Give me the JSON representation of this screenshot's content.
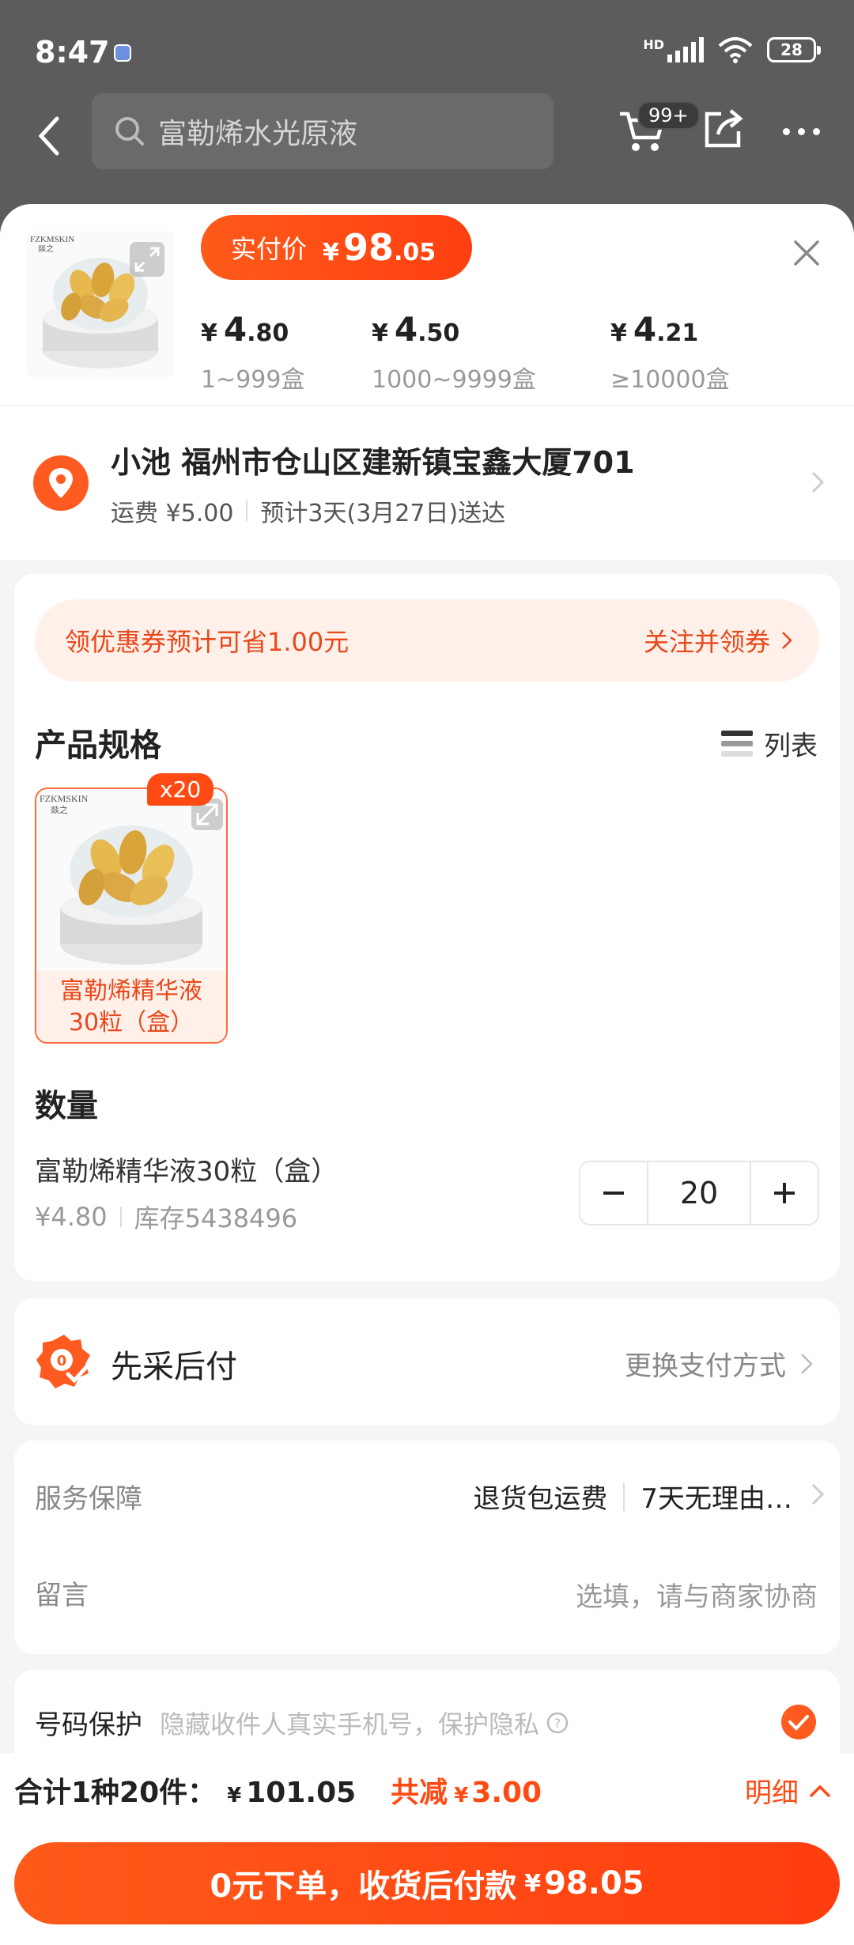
{
  "status_bar": {
    "time": "8:47",
    "network": "HD",
    "battery": "28"
  },
  "nav": {
    "search_text": "富勒烯水光原液",
    "cart_count": "99+"
  },
  "product": {
    "brand_mark": "FZKMSKIN",
    "brand_sub": "燚之",
    "price_label": "实付价",
    "currency": "¥",
    "price_int": "98",
    "price_dec": ".05",
    "tiers": [
      {
        "int": "4",
        "dec": ".80",
        "range": "1~999盒"
      },
      {
        "int": "4",
        "dec": ".50",
        "range": "1000~9999盒"
      },
      {
        "int": "4",
        "dec": ".21",
        "range": "≥10000盒"
      }
    ]
  },
  "address": {
    "line": "小池 福州市仓山区建新镇宝鑫大厦701",
    "shipping": "运费 ¥5.00",
    "eta": "预计3天(3月27日)送达"
  },
  "coupon": {
    "text": "领优惠券预计可省1.00元",
    "action": "关注并领券"
  },
  "spec": {
    "title": "产品规格",
    "view_label": "列表",
    "sku": {
      "line1": "富勒烯精华液",
      "line2": "30粒（盒）",
      "count": "x20"
    }
  },
  "quantity": {
    "title": "数量",
    "item_name": "富勒烯精华液30粒（盒）",
    "unit_price": "¥4.80",
    "stock": "库存5438496",
    "value": "20"
  },
  "payment": {
    "title": "先采后付",
    "action": "更换支付方式"
  },
  "service": {
    "label": "服务保障",
    "tag1": "退货包运费",
    "tag2": "7天无理由…",
    "msg_label": "留言",
    "msg_placeholder": "选填，请与商家协商"
  },
  "privacy": {
    "label": "号码保护",
    "hint": "隐藏收件人真实手机号，保护隐私"
  },
  "summary": {
    "total_label": "合计1种20件：",
    "total_int": "101.05",
    "discount_label": "共减",
    "discount_amt": "3.00",
    "detail": "明细",
    "order_text": "0元下单，收货后付款",
    "order_amt": "98.05"
  },
  "colors": {
    "accent": "#ff4a14",
    "accent_soft": "#fff1ea"
  }
}
